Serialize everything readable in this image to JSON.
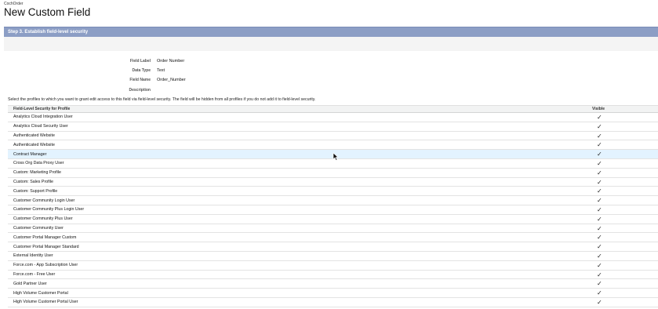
{
  "header": {
    "breadcrumb": "CochOrder",
    "title": "New Custom Field"
  },
  "step": {
    "title": "Step 3. Establish field-level security"
  },
  "field_details": [
    {
      "label": "Field Label",
      "value": "Order Number"
    },
    {
      "label": "Data Type",
      "value": "Text"
    },
    {
      "label": "Field Name",
      "value": "Order_Number"
    },
    {
      "label": "Description",
      "value": ""
    }
  ],
  "instructions": "Select the profiles to which you want to grant edit access to this field via field-level security. The field will be hidden from all profiles if you do not add it to field-level security.",
  "table": {
    "header_profile": "Field-Level Security for Profile",
    "header_visible": "Visible",
    "rows": [
      {
        "profile": "Analytics Cloud Integration User",
        "visible": "✓"
      },
      {
        "profile": "Analytics Cloud Security User",
        "visible": "✓"
      },
      {
        "profile": "Authenticated Website",
        "visible": "✓"
      },
      {
        "profile": "Authenticated Website",
        "visible": "✓"
      },
      {
        "profile": "Contract Manager",
        "visible": "✓"
      },
      {
        "profile": "Cross Org Data Proxy User",
        "visible": "✓"
      },
      {
        "profile": "Custom: Marketing Profile",
        "visible": "✓"
      },
      {
        "profile": "Custom: Sales Profile",
        "visible": "✓"
      },
      {
        "profile": "Custom: Support Profile",
        "visible": "✓"
      },
      {
        "profile": "Customer Community Login User",
        "visible": "✓"
      },
      {
        "profile": "Customer Community Plus Login User",
        "visible": "✓"
      },
      {
        "profile": "Customer Community Plus User",
        "visible": "✓"
      },
      {
        "profile": "Customer Community User",
        "visible": "✓"
      },
      {
        "profile": "Customer Portal Manager Custom",
        "visible": "✓"
      },
      {
        "profile": "Customer Portal Manager Standard",
        "visible": "✓"
      },
      {
        "profile": "External Identity User",
        "visible": "✓"
      },
      {
        "profile": "Force.com - App Subscription User",
        "visible": "✓"
      },
      {
        "profile": "Force.com - Free User",
        "visible": "✓"
      },
      {
        "profile": "Gold Partner User",
        "visible": "✓"
      },
      {
        "profile": "High Volume Customer Portal",
        "visible": "✓"
      },
      {
        "profile": "High Volume Customer Portal User",
        "visible": "✓"
      }
    ],
    "highlight_row": 4
  }
}
